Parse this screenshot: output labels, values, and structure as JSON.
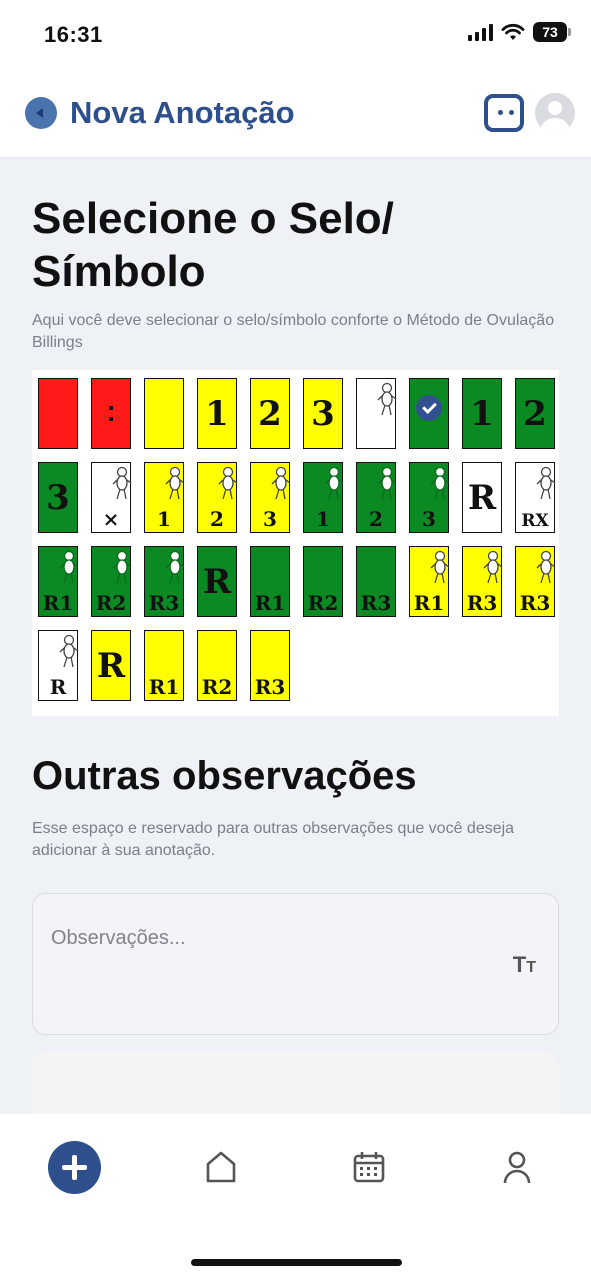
{
  "status": {
    "time": "16:31",
    "battery": "73"
  },
  "header": {
    "title": "Nova Anotação"
  },
  "section1": {
    "title": "Selecione o Selo/ Símbolo",
    "description": "Aqui você deve selecionar o selo/símbolo conforte o Método de Ovulação Billings"
  },
  "stamps": {
    "row1": [
      {
        "color": "#ff1a1a",
        "text": ""
      },
      {
        "color": "#ff1a1a",
        "text": ":"
      },
      {
        "color": "#ffff00",
        "text": ""
      },
      {
        "color": "#ffff00",
        "text": "1"
      },
      {
        "color": "#ffff00",
        "text": "2"
      },
      {
        "color": "#ffff00",
        "text": "3"
      },
      {
        "color": "#ffffff",
        "text": "",
        "baby": true
      },
      {
        "color": "#0b8a23",
        "text": "",
        "selected": true
      },
      {
        "color": "#0b8a23",
        "text": "1"
      },
      {
        "color": "#0b8a23",
        "text": "2"
      }
    ],
    "row2": [
      {
        "color": "#0b8a23",
        "text": "3"
      },
      {
        "color": "#ffffff",
        "text": "×",
        "baby": true
      },
      {
        "color": "#ffff00",
        "text": "1",
        "baby": true
      },
      {
        "color": "#ffff00",
        "text": "2",
        "baby": true
      },
      {
        "color": "#ffff00",
        "text": "3",
        "baby": true
      },
      {
        "color": "#0b8a23",
        "text": "1",
        "baby": true
      },
      {
        "color": "#0b8a23",
        "text": "2",
        "baby": true
      },
      {
        "color": "#0b8a23",
        "text": "3",
        "baby": true
      },
      {
        "color": "#ffffff",
        "text": "R"
      },
      {
        "color": "#ffffff",
        "text": "RX",
        "baby": true
      }
    ],
    "row3": [
      {
        "color": "#0b8a23",
        "text": "R1",
        "baby": true
      },
      {
        "color": "#0b8a23",
        "text": "R2",
        "baby": true
      },
      {
        "color": "#0b8a23",
        "text": "R3",
        "baby": true
      },
      {
        "color": "#0b8a23",
        "text": "R"
      },
      {
        "color": "#0b8a23",
        "text": "R1"
      },
      {
        "color": "#0b8a23",
        "text": "R2"
      },
      {
        "color": "#0b8a23",
        "text": "R3"
      },
      {
        "color": "#ffff00",
        "text": "R1",
        "baby": true
      },
      {
        "color": "#ffff00",
        "text": "R3",
        "baby": true
      },
      {
        "color": "#ffff00",
        "text": "R3",
        "baby": true
      }
    ],
    "row4": [
      {
        "color": "#ffffff",
        "text": "R",
        "baby": true
      },
      {
        "color": "#ffff00",
        "text": "R"
      },
      {
        "color": "#ffff00",
        "text": "R1"
      },
      {
        "color": "#ffff00",
        "text": "R2"
      },
      {
        "color": "#ffff00",
        "text": "R3"
      }
    ]
  },
  "section2": {
    "title": "Outras observações",
    "description": "Esse espaço e reservado para outras observações que você deseja adicionar à sua anotação.",
    "placeholder": "Observações...",
    "format_icon": "text-size-icon"
  },
  "tabbar": {
    "items": [
      {
        "icon": "plus-icon"
      },
      {
        "icon": "home-icon"
      },
      {
        "icon": "calendar-icon"
      },
      {
        "icon": "profile-icon"
      }
    ]
  }
}
